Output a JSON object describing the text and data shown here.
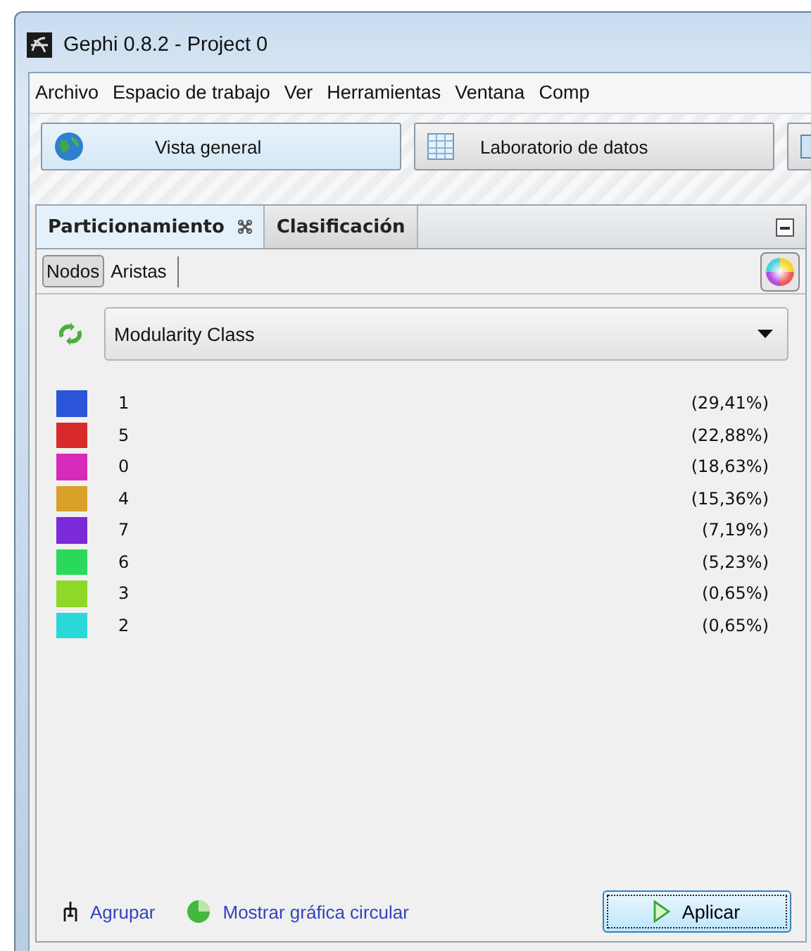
{
  "window": {
    "title": "Gephi 0.8.2 - Project 0"
  },
  "menu": [
    "Archivo",
    "Espacio de trabajo",
    "Ver",
    "Herramientas",
    "Ventana",
    "Comp"
  ],
  "workspace_buttons": [
    {
      "label": "Vista general",
      "kind": "globe",
      "selected": true
    },
    {
      "label": "Laboratorio de datos",
      "kind": "table",
      "selected": false
    },
    {
      "kind": "partial",
      "selected": false
    }
  ],
  "panel_tabs": [
    {
      "label": "Particionamiento",
      "selected": true,
      "closable": true
    },
    {
      "label": "Clasificación",
      "selected": false,
      "closable": false
    }
  ],
  "sub_tabs": [
    {
      "label": "Nodos",
      "selected": true
    },
    {
      "label": "Aristas",
      "selected": false
    }
  ],
  "partition_select": {
    "value": "Modularity Class"
  },
  "partitions": [
    {
      "label": "1",
      "percent": "(29,41%)",
      "color": "#2a55d8"
    },
    {
      "label": "5",
      "percent": "(22,88%)",
      "color": "#d82a2a"
    },
    {
      "label": "0",
      "percent": "(18,63%)",
      "color": "#d82ab8"
    },
    {
      "label": "4",
      "percent": "(15,36%)",
      "color": "#d9a12a"
    },
    {
      "label": "7",
      "percent": "(7,19%)",
      "color": "#7b2ad8"
    },
    {
      "label": "6",
      "percent": "(5,23%)",
      "color": "#2ad85a"
    },
    {
      "label": "3",
      "percent": "(0,65%)",
      "color": "#8ed82a"
    },
    {
      "label": "2",
      "percent": "(0,65%)",
      "color": "#2ad8d8"
    }
  ],
  "footer": {
    "group_link": "Agrupar",
    "pie_link": "Mostrar gráfica circular",
    "apply_button": "Aplicar"
  }
}
